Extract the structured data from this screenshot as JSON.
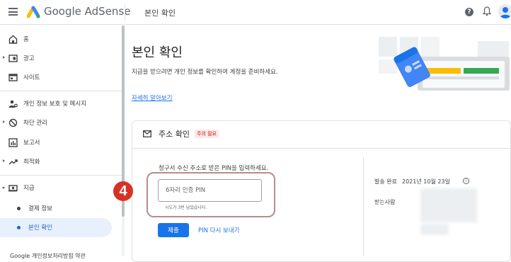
{
  "topbar": {
    "brand": "Google AdSense",
    "page_name": "본인 확인",
    "help_glyph": "?"
  },
  "sidebar": {
    "items": [
      {
        "label": "홈",
        "icon": "home-icon"
      },
      {
        "label": "광고",
        "icon": "ads-icon"
      },
      {
        "label": "사이트",
        "icon": "sites-icon"
      },
      {
        "label": "개인 정보 보호 및 메시지",
        "icon": "privacy-icon"
      },
      {
        "label": "차단 관리",
        "icon": "block-icon"
      },
      {
        "label": "보고서",
        "icon": "reports-icon"
      },
      {
        "label": "최적화",
        "icon": "optimization-icon"
      },
      {
        "label": "지급",
        "icon": "payments-icon"
      },
      {
        "label": "결제 정보",
        "icon": "dot"
      },
      {
        "label": "본인 확인",
        "icon": "dot"
      }
    ],
    "footer": "Google 개인정보처리방침 약관"
  },
  "main": {
    "title": "본인 확인",
    "description": "지급을 받으려면 개인 정보를 확인하여 계정을 준비하세요.",
    "learn_more": "자세히 알아보기",
    "card": {
      "title": "주소 확인",
      "badge": "주의 필요",
      "instruction": "청구서 수신 주소로 받은 PIN을 입력하세요.",
      "pin_placeholder": "6자리 인증 PIN",
      "pin_value": "",
      "hint": "시도가 3번 남았습니다.",
      "submit_label": "제출",
      "resend_label": "PIN 다시 보내기",
      "sent_label": "발송 완료",
      "sent_date": "2021년 10월 23일",
      "recipient_label": "받는사람"
    },
    "step_number": "4"
  },
  "colors": {
    "accent": "#1a73e8",
    "active_bg": "#e8f0fe",
    "step_badge": "#d93025",
    "highlight_border": "#b98b8e",
    "badge_text": "#c5221f"
  }
}
